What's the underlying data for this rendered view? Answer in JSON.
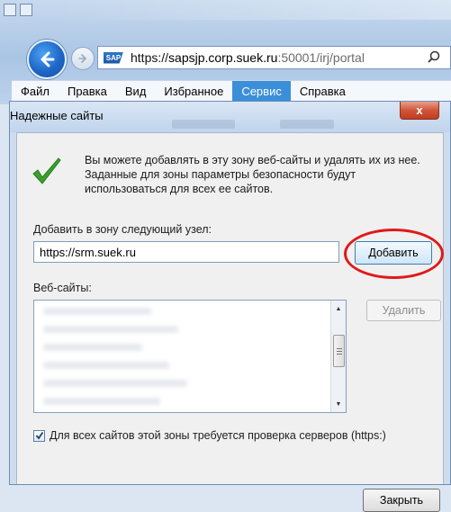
{
  "browser": {
    "url_prefix": "https://",
    "url_host": "sapsjp.corp.suek.ru",
    "url_rest": ":50001/irj/portal",
    "site_logo": "SAP",
    "menu": [
      {
        "label": "Файл"
      },
      {
        "label": "Правка"
      },
      {
        "label": "Вид"
      },
      {
        "label": "Избранное"
      },
      {
        "label": "Сервис",
        "active": true
      },
      {
        "label": "Справка"
      }
    ]
  },
  "dialog": {
    "title": "Надежные сайты",
    "close_glyph": "x",
    "info_text": "Вы можете добавлять в эту зону  веб-сайты и удалять их из нее. Заданные для зоны параметры безопасности будут использоваться для всех ее сайтов.",
    "add_label": "Добавить в зону следующий узел:",
    "add_input_value": "https://srm.suek.ru",
    "add_button": "Добавить",
    "sites_label": "Веб-сайты:",
    "remove_button": "Удалить",
    "https_checkbox_label": "Для всех сайтов этой зоны требуется проверка серверов (https:)",
    "https_checked": true,
    "close_button": "Закрыть"
  },
  "colors": {
    "highlight_ring": "#e01919",
    "active_menu": "#3b8fd8",
    "check_green": "#3aa02b"
  }
}
